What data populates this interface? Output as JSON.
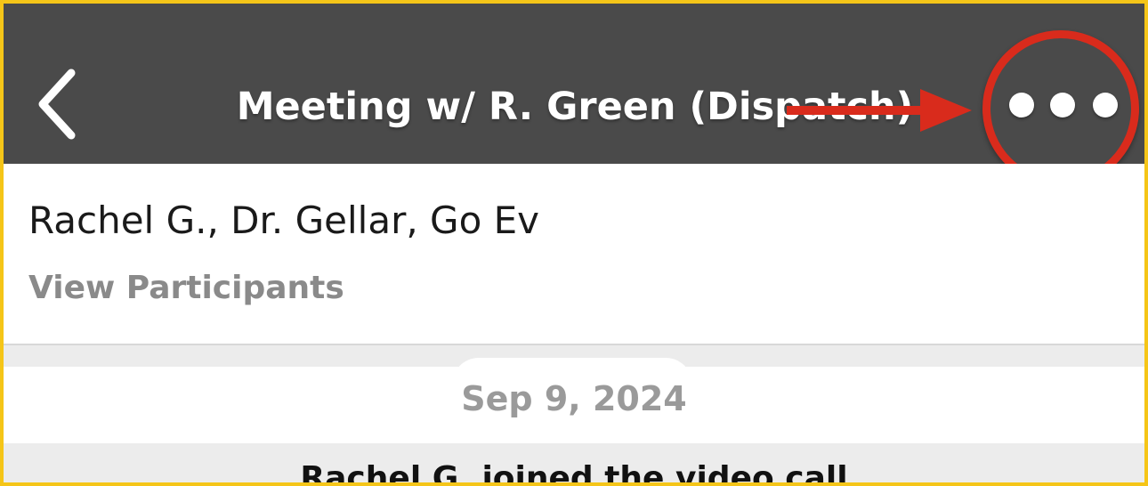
{
  "header": {
    "title": "Meeting w/ R. Green (Dispatch)",
    "back_icon": "chevron-left-icon",
    "more_icon": "more-horizontal-icon"
  },
  "participants": {
    "names": "Rachel G., Dr. Gellar, Go Ev",
    "view_link": "View Participants"
  },
  "chat": {
    "date": "Sep 9, 2024",
    "system_message": "Rachel G. joined the video call"
  },
  "colors": {
    "header_bg": "#4a4a4a",
    "annotation": "#d92b1c",
    "frame_border": "#f5c518",
    "muted_text": "#8a8a8a"
  }
}
